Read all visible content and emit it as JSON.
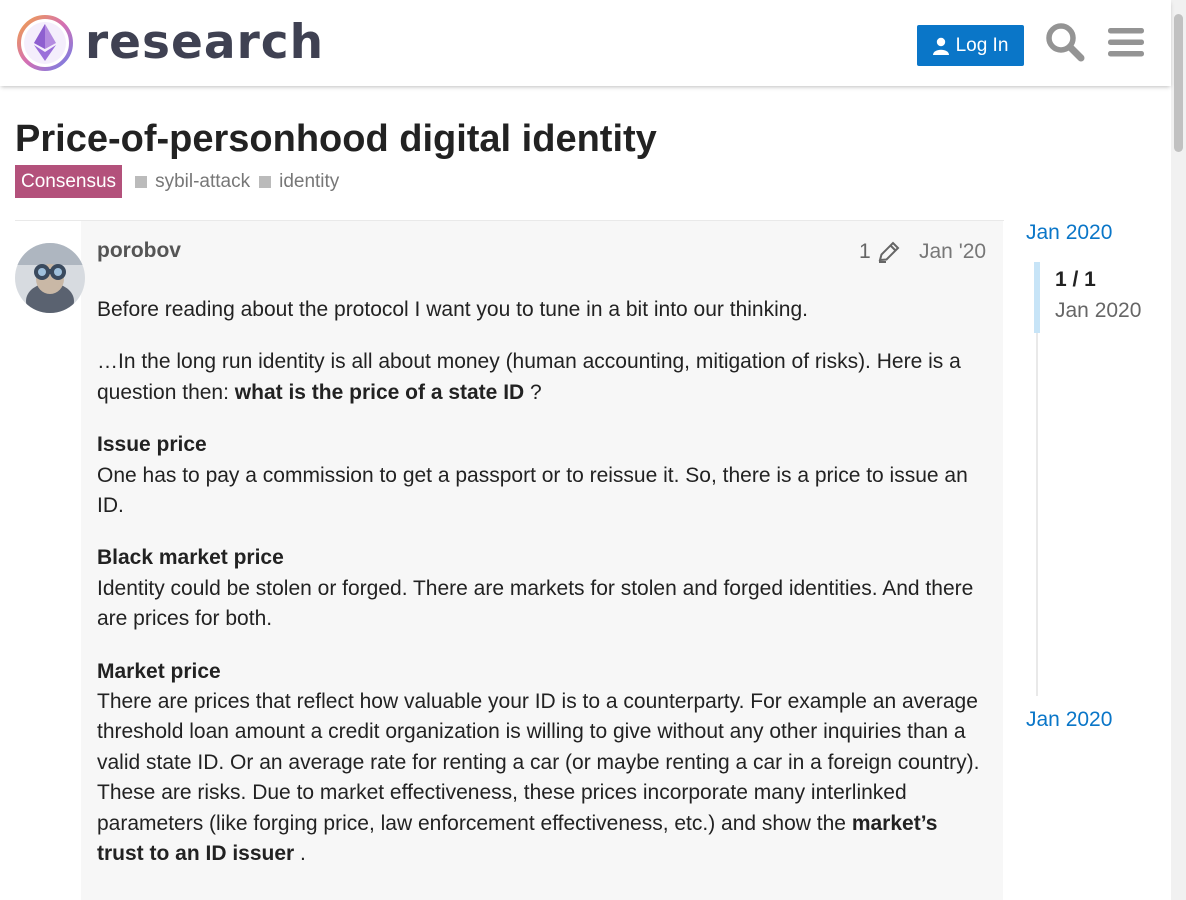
{
  "header": {
    "logo_text": "research",
    "login_label": "Log In",
    "search_icon": "search-icon",
    "menu_icon": "hamburger-menu-icon",
    "brand_color": "#0a76c8"
  },
  "topic": {
    "title": "Price-of-personhood digital identity",
    "category": "Consensus",
    "category_color": "#b3517b",
    "tags": [
      "sybil-attack",
      "identity"
    ]
  },
  "post": {
    "username": "porobov",
    "edit_count": "1",
    "date": "Jan '20",
    "paragraphs": [
      {
        "text": "Before reading about the protocol I want you to tune in a bit into our thinking."
      },
      {
        "text": "…In the long run identity is all about money (human accounting, mitigation of risks). Here is a question then: ",
        "bold": "what is the price of a state ID",
        "after": " ?"
      },
      {
        "heading": "Issue price",
        "text": "One has to pay a commission to get a passport or to reissue it. So, there is a price to issue an ID."
      },
      {
        "heading": "Black market price",
        "text": "Identity could be stolen or forged. There are markets for stolen and forged identities. And there are prices for both."
      },
      {
        "heading": "Market price",
        "text": "There are prices that reflect how valuable your ID is to a counterparty. For example an average threshold loan amount a credit organization is willing to give without any other inquiries than a valid state ID. Or an average rate for renting a car (or maybe renting a car in a foreign country). These are risks. Due to market effectiveness, these prices incorporate many interlinked parameters (like forging price, law enforcement effectiveness, etc.) and show the ",
        "bold": "market’s trust to an ID issuer",
        "after": " ."
      }
    ]
  },
  "timeline": {
    "top_date": "Jan 2020",
    "counter": "1 / 1",
    "handle_date": "Jan 2020",
    "bottom_date": "Jan 2020"
  }
}
